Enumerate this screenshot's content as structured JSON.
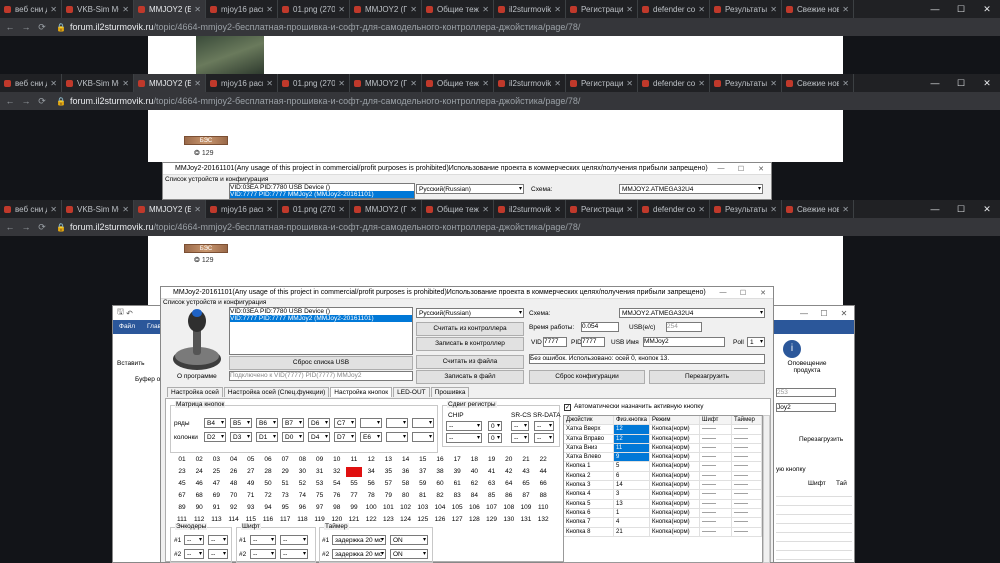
{
  "browser": {
    "tabs": [
      "веб сни дисп",
      "VKB-Sim MCG",
      "MMJOY2 (Бес",
      "mjoy16 распа",
      "01.png (2700",
      "MMJOY2 (Г",
      "Общие теж",
      "il2sturmovik",
      "Регистрация",
      "defender cob",
      "Результаты п",
      "Свежие нові"
    ],
    "window_controls": [
      "—",
      "☐",
      "✕"
    ],
    "host": "forum.il2sturmovik.ru",
    "path": "/topic/4664-mmjoy2-бесплатная-прошивка-и-софт-для-самодельного-контроллера-джойстика/page/78/"
  },
  "forum": {
    "badge": "БЭС",
    "count": "129"
  },
  "dialog": {
    "title": "MMJoy2-20161101(Any usage of this project in commercial/profit purposes is prohibited)Использование проекта в коммерческих целях/получения прибыли запрещено)",
    "devices_label": "Список устройств и конфигурация",
    "devices": [
      "VID:03EA PID:7780 USB Device ()",
      "VID:7777 PID:7777 MMJoy2 (MMJoy2-20161101)"
    ],
    "lang": "Русский(Russian)",
    "scheme_label": "Схема:",
    "scheme": "MMJOY2.ATMEGA32U4",
    "btn_read": "Считать из контроллера",
    "btn_write": "Записать в контроллер",
    "btn_read_file": "Считать из файла",
    "btn_write_file": "Записать в файл",
    "btn_reset_list": "Сброс списка USB",
    "btn_reset_cfg": "Сброс конфигурации",
    "btn_reboot": "Перезагрузить",
    "about": "О программе",
    "connected": "Подключено к VID(7777) PID(7777) MMJoy2",
    "worktime_label": "Время работы:",
    "worktime": "0.054",
    "usb_label": "USB(e/c)",
    "usb": "254",
    "vid_label": "VID",
    "vid": "7777",
    "pid_label": "PID",
    "pid": "7777",
    "usbname_label": "USB Имя",
    "usbname": "MMJoy2",
    "poll_label": "Poll",
    "poll": "1",
    "status": "Без ошибок. Использовано: осей 0, кнопок 13.",
    "tabs": [
      "Настройка осей",
      "Настройка осей (Спец.функции)",
      "Настройка кнопок",
      "LED-OUT",
      "Прошивка"
    ],
    "matrix_label": "Матрица кнопок",
    "rows_label": "ряды",
    "cols_label": "колонки",
    "rows": [
      "B4",
      "B5",
      "B6",
      "B7",
      "D6",
      "C7",
      "",
      "",
      ""
    ],
    "cols": [
      "D2",
      "D3",
      "D1",
      "D0",
      "D4",
      "D7",
      "E6",
      "",
      ""
    ],
    "shift_reg_label": "Сдвиг регистры",
    "chip_label": "CHIP",
    "srcs_label": "SR-CS",
    "srdata_label": "SR-DATA",
    "auto_label": "Автоматически назначить активную кнопку",
    "numbers": [
      "01",
      "02",
      "03",
      "04",
      "05",
      "06",
      "07",
      "08",
      "09",
      "10",
      "11",
      "12",
      "13",
      "14",
      "15",
      "16",
      "17",
      "18",
      "19",
      "20",
      "21",
      "22",
      "23",
      "24",
      "25",
      "26",
      "27",
      "28",
      "29",
      "30",
      "31",
      "32",
      "33",
      "34",
      "35",
      "36",
      "37",
      "38",
      "39",
      "40",
      "41",
      "42",
      "43",
      "44",
      "45",
      "46",
      "47",
      "48",
      "49",
      "50",
      "51",
      "52",
      "53",
      "54",
      "55",
      "56",
      "57",
      "58",
      "59",
      "60",
      "61",
      "62",
      "63",
      "64",
      "65",
      "66",
      "67",
      "68",
      "69",
      "70",
      "71",
      "72",
      "73",
      "74",
      "75",
      "76",
      "77",
      "78",
      "79",
      "80",
      "81",
      "82",
      "83",
      "84",
      "85",
      "86",
      "87",
      "88",
      "89",
      "90",
      "91",
      "92",
      "93",
      "94",
      "95",
      "96",
      "97",
      "98",
      "99",
      "100",
      "101",
      "102",
      "103",
      "104",
      "105",
      "106",
      "107",
      "108",
      "109",
      "110",
      "111",
      "112",
      "113",
      "114",
      "115",
      "116",
      "117",
      "118",
      "119",
      "120",
      "121",
      "122",
      "123",
      "124",
      "125",
      "126",
      "127",
      "128",
      "129",
      "130",
      "131",
      "132"
    ],
    "active_number": "33",
    "encoders_label": "Энкодеры",
    "shift_label": "Шифт",
    "timer_label": "Таймер",
    "timer_delay": "задержка 20 мс",
    "timer_state": "ON",
    "table_headers": [
      "Джойстик",
      "Физ.кнопка",
      "Режим",
      "Шифт",
      "Таймер"
    ],
    "table_rows": [
      [
        "Хатка Вверх",
        "12",
        "Кнопка(норм)",
        "-------",
        "-------"
      ],
      [
        "Хатка Вправо",
        "12",
        "Кнопка(норм)",
        "-------",
        "-------"
      ],
      [
        "Хатка Вниз",
        "11",
        "Кнопка(норм)",
        "-------",
        "-------"
      ],
      [
        "Хатка Влево",
        "9",
        "Кнопка(норм)",
        "-------",
        "-------"
      ],
      [
        "Кнопка 1",
        "5",
        "Кнопка(норм)",
        "-------",
        "-------"
      ],
      [
        "Кнопка 2",
        "6",
        "Кнопка(норм)",
        "-------",
        "-------"
      ],
      [
        "Кнопка 3",
        "14",
        "Кнопка(норм)",
        "-------",
        "-------"
      ],
      [
        "Кнопка 4",
        "3",
        "Кнопка(норм)",
        "-------",
        "-------"
      ],
      [
        "Кнопка 5",
        "13",
        "Кнопка(норм)",
        "-------",
        "-------"
      ],
      [
        "Кнопка 6",
        "1",
        "Кнопка(норм)",
        "-------",
        "-------"
      ],
      [
        "Кнопка 7",
        "4",
        "Кнопка(норм)",
        "-------",
        "-------"
      ],
      [
        "Кнопка 8",
        "21",
        "Кнопка(норм)",
        "-------",
        "-------"
      ]
    ]
  },
  "office": {
    "file_tab": "Файл",
    "home_tab": "Глав",
    "paste": "Вставить",
    "clipboard": "Буфер об",
    "updates": "Оповещение продукта",
    "bg_value": "253",
    "bg_name": "Joy2",
    "bg_reboot": "Перезагрузить",
    "bg_btn": "ую кнопку",
    "bg_shift": "Шифт",
    "bg_timer": "Тай"
  }
}
